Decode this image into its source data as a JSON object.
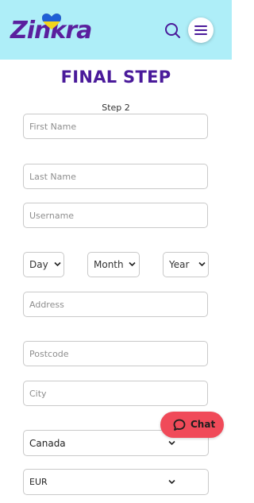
{
  "brand": {
    "logo_text": "Zinkra",
    "heart_colors": {
      "top": "#1f5fd6",
      "bottom": "#f2d51c"
    }
  },
  "header": {
    "search_icon": "search-icon",
    "menu_icon": "hamburger-menu-icon",
    "background": "#aeeef8"
  },
  "page": {
    "title": "FINAL STEP",
    "step": "Step 2"
  },
  "form": {
    "first_name_placeholder": "First Name",
    "last_name_placeholder": "Last Name",
    "username_placeholder": "Username",
    "day_value": "Day",
    "month_value": "Month",
    "year_value": "Year",
    "address_placeholder": "Address",
    "postcode_placeholder": "Postcode",
    "city_placeholder": "City",
    "country_value": "Canada",
    "currency_value": "EUR"
  },
  "chat": {
    "label": "Chat",
    "color": "#f04a59"
  },
  "accent_color": "#4a1a9a"
}
